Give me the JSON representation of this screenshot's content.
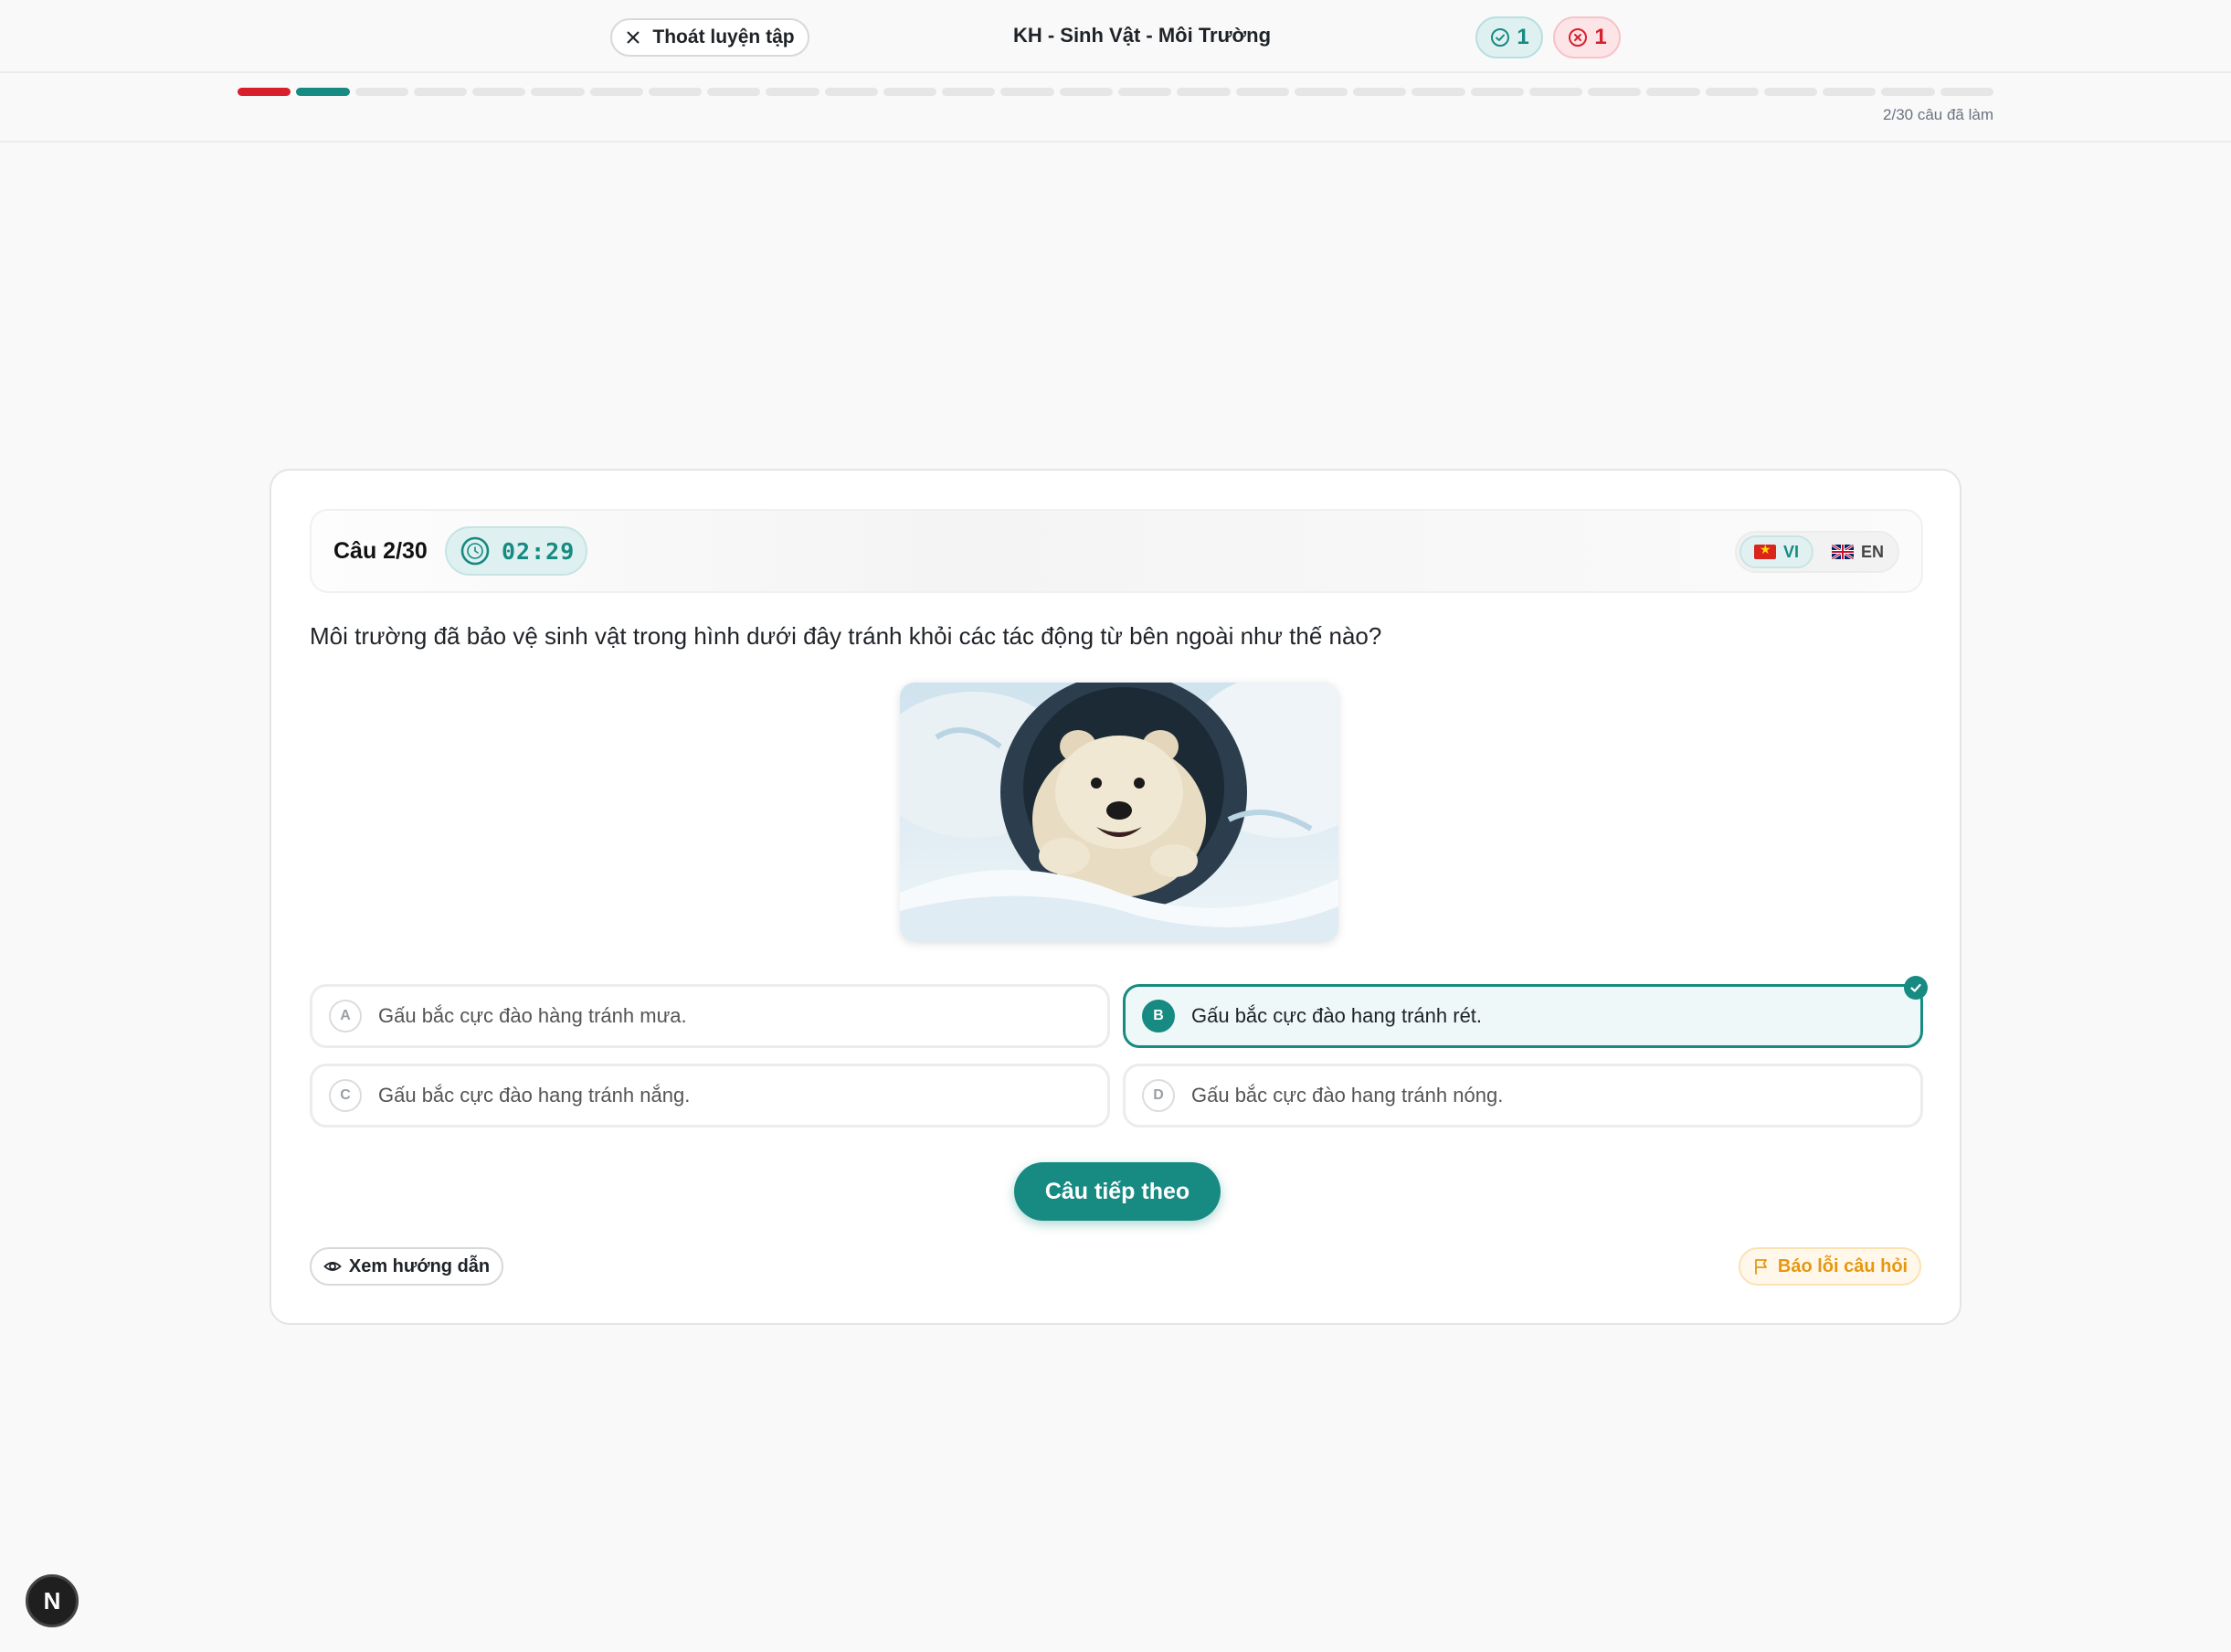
{
  "header": {
    "exit_label": "Thoát luyện tập",
    "title": "KH - Sinh Vật - Môi Trường",
    "correct_count": "1",
    "wrong_count": "1"
  },
  "progress": {
    "total": 30,
    "answered": 2,
    "segment_status": [
      "wrong",
      "correct"
    ],
    "text": "2/30 câu đã làm",
    "colors": {
      "correct": "#178a82",
      "wrong": "#d8202c",
      "pending": "#e6e6e6"
    }
  },
  "question": {
    "number_label": "Câu 2/30",
    "timer": "02:29",
    "lang_vi": "VI",
    "lang_en": "EN",
    "text": "Môi trường đã bảo vệ sinh vật trong hình dưới đây tránh khỏi các tác động từ bên ngoài như thế nào?",
    "options": [
      {
        "key": "A",
        "text": "Gấu bắc cực đào hàng tránh mưa."
      },
      {
        "key": "B",
        "text": "Gấu bắc cực đào hang tránh rét."
      },
      {
        "key": "C",
        "text": "Gấu bắc cực đào hang tránh nắng."
      },
      {
        "key": "D",
        "text": "Gấu bắc cực đào hang tránh nóng."
      }
    ],
    "selected": "B"
  },
  "actions": {
    "next_label": "Câu tiếp theo",
    "guide_label": "Xem hướng dẫn",
    "report_label": "Báo lỗi câu hỏi"
  },
  "misc": {
    "dev_badge": "N"
  }
}
